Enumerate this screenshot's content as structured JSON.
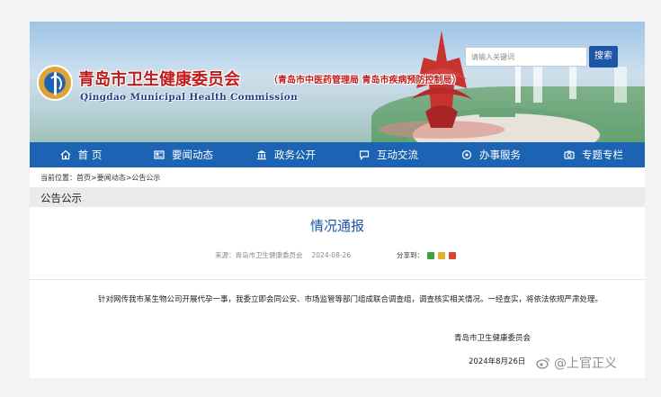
{
  "header": {
    "site_title": "青岛市卫生健康委员会",
    "site_subtitle": "（青岛市中医药管理局 青岛市疾病预防控制局）",
    "site_title_en": "Qingdao Municipal Health Commission",
    "logo_icon": "health-commission-logo-icon",
    "search": {
      "placeholder": "请输入关键词",
      "button_label": "搜索"
    }
  },
  "nav": {
    "items": [
      {
        "label": "首 页",
        "icon": "home-icon"
      },
      {
        "label": "要闻动态",
        "icon": "news-icon"
      },
      {
        "label": "政务公开",
        "icon": "government-icon"
      },
      {
        "label": "互动交流",
        "icon": "chat-icon"
      },
      {
        "label": "办事服务",
        "icon": "service-icon"
      },
      {
        "label": "专题专栏",
        "icon": "special-column-icon"
      }
    ]
  },
  "breadcrumb": {
    "prefix": "当前位置：",
    "items": [
      "首页",
      ">",
      "要闻动态",
      ">",
      "公告公示"
    ]
  },
  "section": {
    "title": "公告公示"
  },
  "article": {
    "title": "情况通报",
    "source_label": "来源：",
    "source": "青岛市卫生健康委员会",
    "date": "2024-08-26",
    "share_label": "分享到：",
    "share_icons": [
      "wechat-share-icon",
      "qzone-share-icon",
      "weibo-share-icon"
    ],
    "body": "针对网传我市某生物公司开展代孕一事，我委立即会同公安、市场监管等部门组成联合调查组，调查核实相关情况。一经查实，将依法依规严肃处理。",
    "sign_org": "青岛市卫生健康委员会",
    "sign_date": "2024年8月26日"
  },
  "watermark": {
    "icon": "weibo-icon",
    "text": "@上官正义"
  },
  "colors": {
    "nav_bg": "#1d63b3",
    "title_red": "#c31c1c",
    "title_blue": "#1d56a6",
    "section_bg": "#e9eaec"
  }
}
